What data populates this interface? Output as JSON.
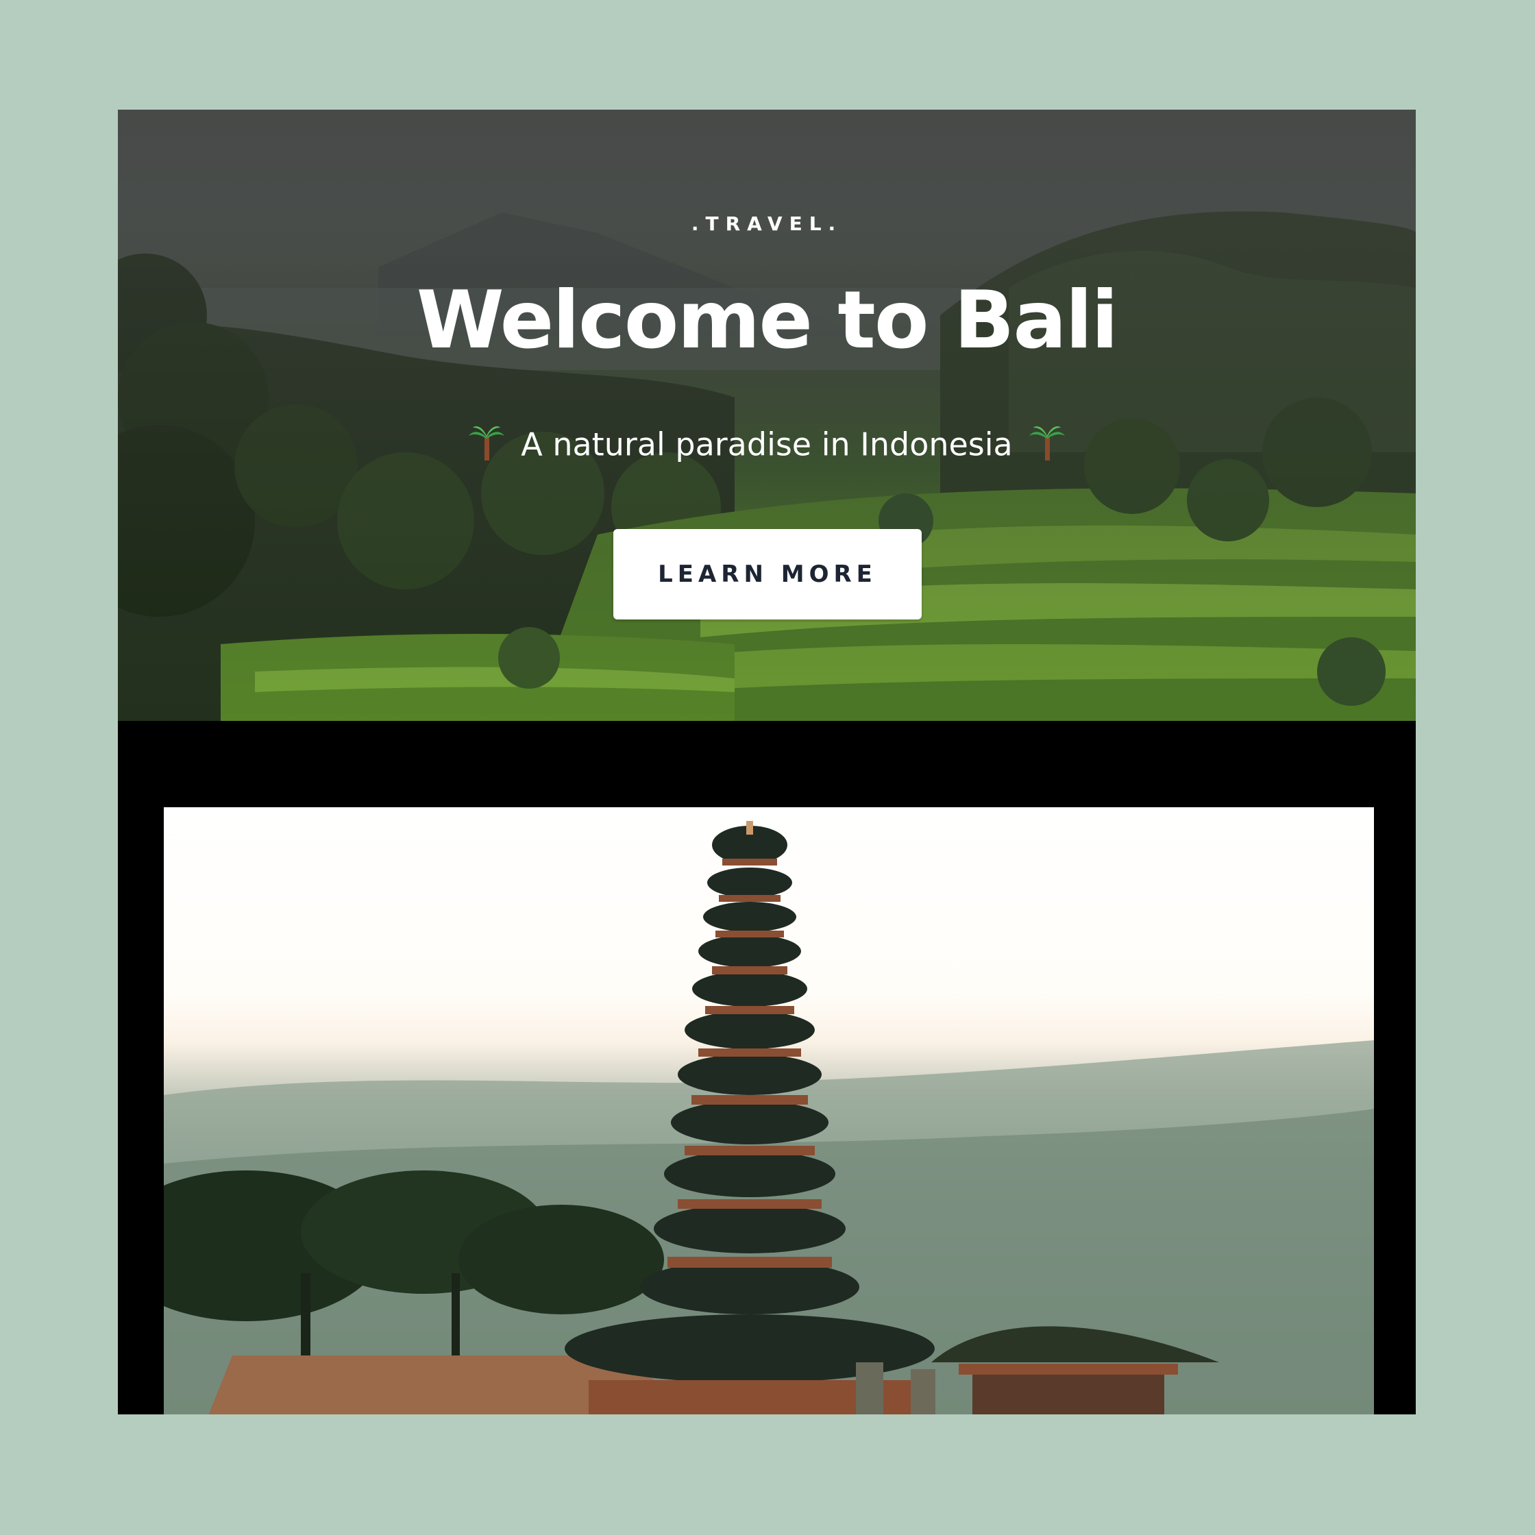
{
  "hero": {
    "eyebrow": ".TRAVEL.",
    "title": "Welcome to Bali",
    "tagline": "A natural paradise in Indonesia",
    "tagline_icon": "palm-tree-icon",
    "cta_label": "LEARN MORE"
  },
  "images": {
    "hero_background": "rice-terraces-landscape",
    "feature": "pagoda-temple-lake"
  },
  "colors": {
    "page_background": "#b4cdbf",
    "frame": "#000000",
    "button_bg": "#ffffff",
    "button_text": "#1d2433"
  }
}
